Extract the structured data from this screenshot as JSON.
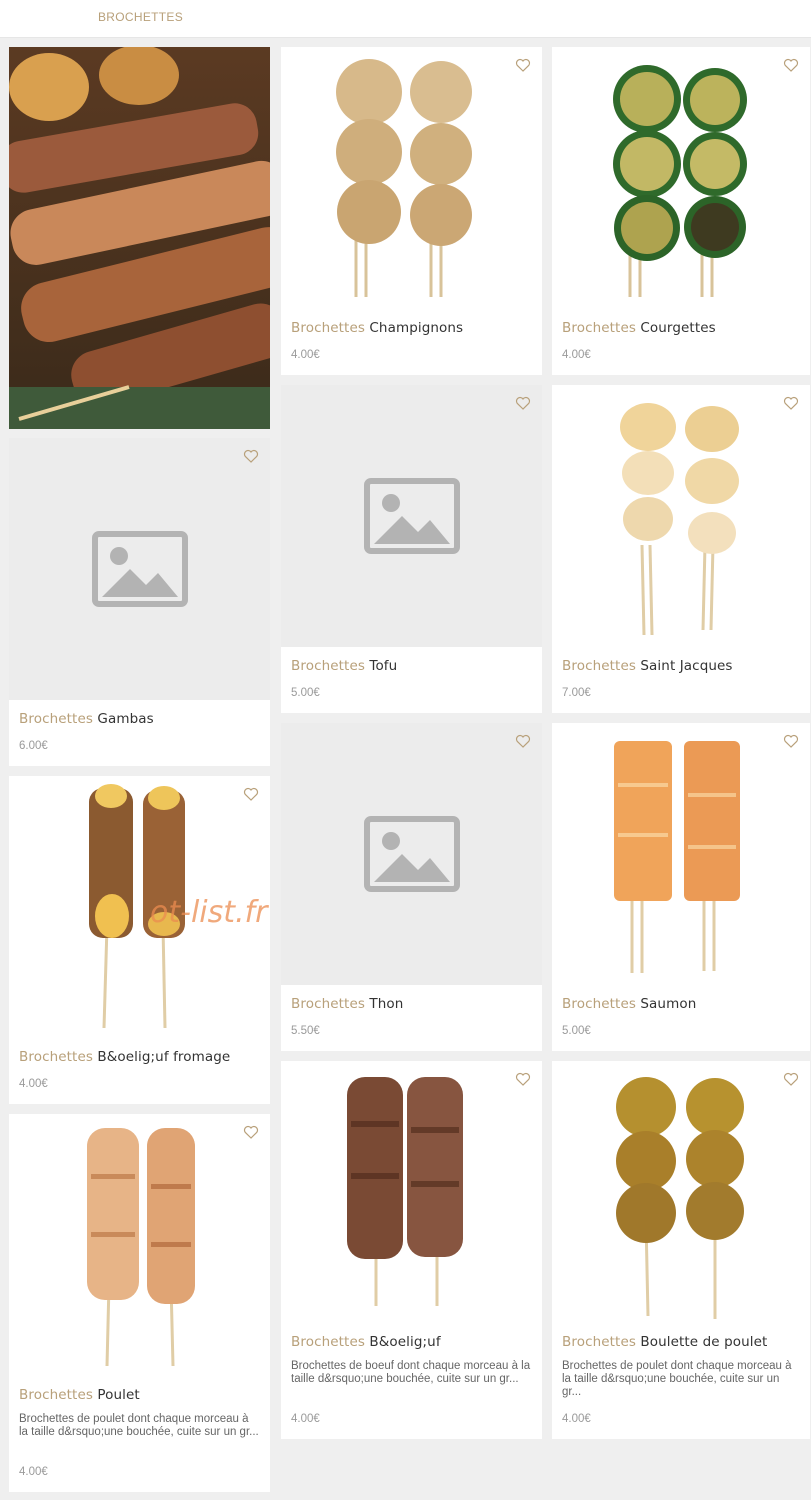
{
  "header": {
    "breadcrumb": "BROCHETTES"
  },
  "category_prefix": "Brochettes",
  "products": {
    "champignons": {
      "name": "Champignons",
      "price": "4.00€"
    },
    "courgettes": {
      "name": "Courgettes",
      "price": "4.00€"
    },
    "tofu": {
      "name": "Tofu",
      "price": "5.00€"
    },
    "saint_jacques": {
      "name": "Saint Jacques",
      "price": "7.00€"
    },
    "gambas": {
      "name": "Gambas",
      "price": "6.00€"
    },
    "thon": {
      "name": "Thon",
      "price": "5.50€"
    },
    "saumon": {
      "name": "Saumon",
      "price": "5.00€"
    },
    "boeuf_fromage": {
      "name": "B&oelig;uf fromage",
      "price": "4.00€"
    },
    "poulet": {
      "name": "Poulet",
      "price": "4.00€",
      "desc": "Brochettes de poulet dont chaque morceau à la taille d&rsquo;une bouchée, cuite sur un gr..."
    },
    "boeuf": {
      "name": "B&oelig;uf",
      "price": "4.00€",
      "desc": "Brochettes de boeuf dont chaque morceau à la taille d&rsquo;une bouchée, cuite sur un gr..."
    },
    "boulette": {
      "name": "Boulette de poulet",
      "price": "4.00€",
      "desc": "Brochettes de poulet dont chaque morceau à la taille d&rsquo;une bouchée, cuite sur un gr..."
    }
  },
  "watermark": "ot-list.fr",
  "colors": {
    "accent": "#b8a07a",
    "background": "#efefef",
    "card": "#ffffff"
  }
}
